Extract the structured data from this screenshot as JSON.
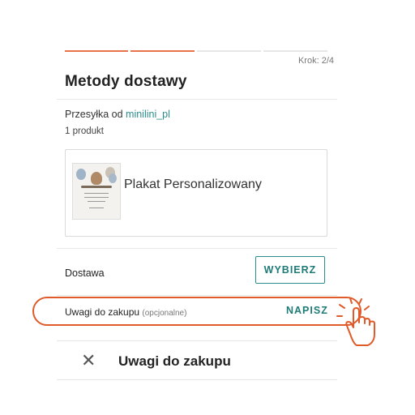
{
  "progress": {
    "total_steps": 4,
    "completed_steps": 2
  },
  "step_label": "Krok: 2/4",
  "page_title": "Metody dostawy",
  "shipment": {
    "prefix": "Przesyłka od ",
    "seller": "minilini_pl",
    "count_text": "1 produkt"
  },
  "product": {
    "name": "Plakat Personalizowany"
  },
  "delivery": {
    "label": "Dostawa",
    "button": "WYBIERZ"
  },
  "notes": {
    "label": "Uwagi do zakupu",
    "optional": "(opcjonalne)",
    "button": "NAPISZ"
  },
  "dialog": {
    "title": "Uwagi do zakupu",
    "close_icon": "close-icon"
  },
  "colors": {
    "accent": "#e8734a",
    "teal": "#2b8e8a",
    "highlight": "#e05a2a"
  }
}
